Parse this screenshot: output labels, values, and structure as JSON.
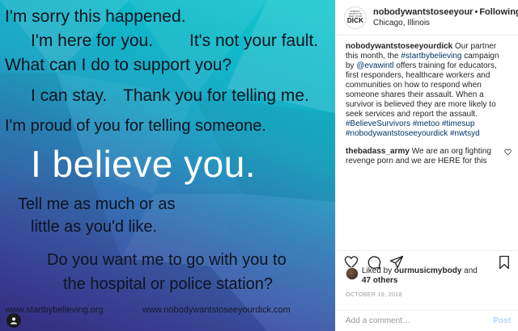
{
  "image": {
    "lines": [
      "I'm sorry this happened.",
      "I'm here for you.",
      "It's not your fault.",
      "What can I do to support you?",
      "I can stay.",
      "Thank you for telling me.",
      "I'm proud of you for telling someone.",
      "I believe you.",
      "Tell me as much or as",
      "little as you'd like.",
      "Do you want me to go with you to",
      "the hospital or police station?"
    ],
    "footer_left": "www.startbybelieving.org",
    "footer_right": "www.nobodywantstoseeyourdick.com"
  },
  "header": {
    "logo": {
      "small": [
        "NOBODY",
        "WANTS TO",
        "SEE YOUR"
      ],
      "word": "DICK"
    },
    "username": "nobodywantstoseeyour",
    "separator": "•",
    "follow_label": "Following",
    "location": "Chicago, Illinois"
  },
  "caption": {
    "user": "nobodywantstoseeyourdick",
    "text_a": " Our partner this month, the ",
    "tag_a": "#startbybelieving",
    "text_b": " campaign by ",
    "tag_b": "@evawintl",
    "text_c": " offers training for educators, first responders, healthcare workers and communities on how to respond when someone shares their assault. When a survivor is believed they are more likely to seek services and report the assault. ",
    "tags_c": "#BelieveSurvivors #metoo #timesup #nobodywantstoseeyourdick #nwtsyd"
  },
  "comment": {
    "user": "thebadass_army",
    "text": " We are an org fighting revenge porn and we are HERE for this"
  },
  "likes": {
    "prefix": "Liked by ",
    "user": "ourmusicmybody",
    "joiner": " and",
    "count": "47 others"
  },
  "date": "OCTOBER 19, 2018",
  "add_comment": {
    "placeholder": "Add a comment…",
    "post_label": "Post"
  },
  "icons": [
    "heart-icon",
    "comment-icon",
    "share-icon",
    "bookmark-icon",
    "user-tag-icon",
    "heart-small-icon"
  ]
}
